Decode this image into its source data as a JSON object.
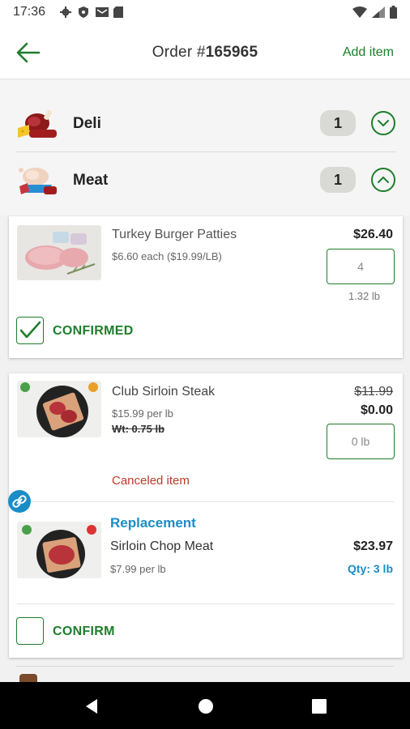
{
  "status_bar": {
    "time": "17:36"
  },
  "header": {
    "order_label": "Order #",
    "order_number": "165965",
    "add_item_label": "Add item"
  },
  "categories": [
    {
      "name": "Deli",
      "count": "1",
      "expanded": false
    },
    {
      "name": "Meat",
      "count": "1",
      "expanded": true
    }
  ],
  "items": [
    {
      "name": "Turkey Burger Patties",
      "unit_price": "$6.60 each ($19.99/LB)",
      "price": "$26.40",
      "qty_value": "4",
      "weight": "1.32 lb",
      "status_label": "CONFIRMED",
      "confirmed": true
    },
    {
      "name": "Club Sirloin Steak",
      "unit_price": "$15.99 per lb",
      "weight_label": "Wt: 0.75 lb",
      "original_price": "$11.99",
      "price": "$0.00",
      "qty_value": "0 lb",
      "canceled_label": "Canceled item",
      "replacement": {
        "heading": "Replacement",
        "name": "Sirloin Chop Meat",
        "unit_price": "$7.99 per lb",
        "price": "$23.97",
        "qty": "Qty: 3 lb"
      },
      "confirm_label": "CONFIRM",
      "confirmed": false
    }
  ],
  "colors": {
    "accent_green": "#1e7d2b",
    "replacement_blue": "#1a8dc7",
    "canceled_red": "#c0392b"
  }
}
